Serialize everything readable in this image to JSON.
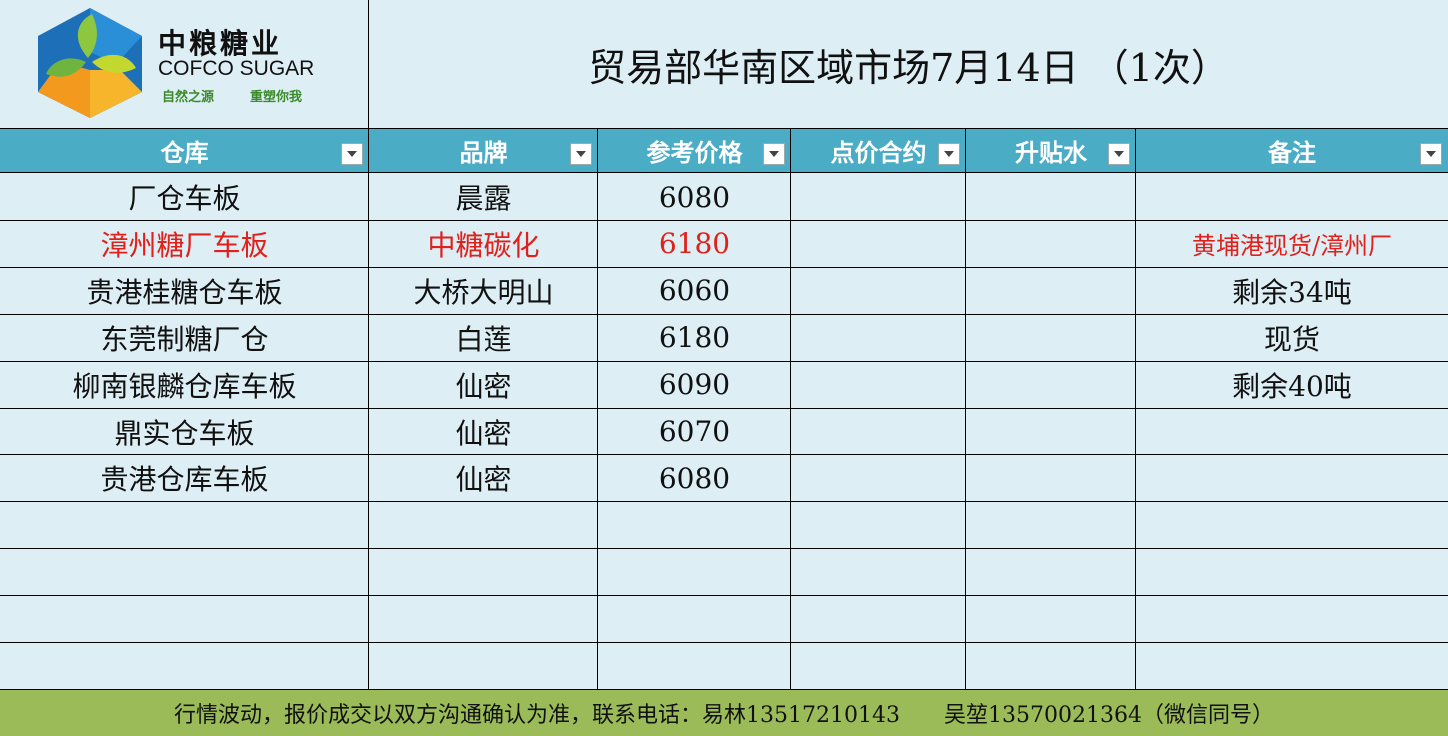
{
  "logo": {
    "cn": "中粮糖业",
    "en": "COFCO SUGAR",
    "slogan_left": "自然之源",
    "slogan_right": "重塑你我",
    "colors": {
      "blue": "#1d6fb8",
      "green": "#8dc63f",
      "orange": "#f39a1e"
    }
  },
  "title": "贸易部华南区域市场7月14日 （1次）",
  "columns": [
    "仓库",
    "品牌",
    "参考价格",
    "点价合约",
    "升贴水",
    "备注"
  ],
  "rows": [
    {
      "warehouse": "厂仓车板",
      "brand": "晨露",
      "price": "6080",
      "contract": "",
      "premium": "",
      "note": "",
      "highlight": false
    },
    {
      "warehouse": "漳州糖厂车板",
      "brand": "中糖碳化",
      "price": "6180",
      "contract": "",
      "premium": "",
      "note": "黄埔港现货/漳州厂",
      "highlight": true
    },
    {
      "warehouse": "贵港桂糖仓车板",
      "brand": "大桥大明山",
      "price": "6060",
      "contract": "",
      "premium": "",
      "note": "剩余34吨",
      "highlight": false
    },
    {
      "warehouse": "东莞制糖厂仓",
      "brand": "白莲",
      "price": "6180",
      "contract": "",
      "premium": "",
      "note": "现货",
      "highlight": false
    },
    {
      "warehouse": "柳南银麟仓库车板",
      "brand": "仙密",
      "price": "6090",
      "contract": "",
      "premium": "",
      "note": "剩余40吨",
      "highlight": false
    },
    {
      "warehouse": "鼎实仓车板",
      "brand": "仙密",
      "price": "6070",
      "contract": "",
      "premium": "",
      "note": "",
      "highlight": false
    },
    {
      "warehouse": "贵港仓库车板",
      "brand": "仙密",
      "price": "6080",
      "contract": "",
      "premium": "",
      "note": "",
      "highlight": false
    }
  ],
  "empty_rows": 4,
  "footer": "行情波动，报价成交以双方沟通确认为准，联系电话：易林13517210143　　吴堃13570021364（微信同号）",
  "colors": {
    "background": "#ddeef5",
    "header": "#4bacc6",
    "footer": "#9bbb59",
    "highlight_text": "#e0201a"
  }
}
